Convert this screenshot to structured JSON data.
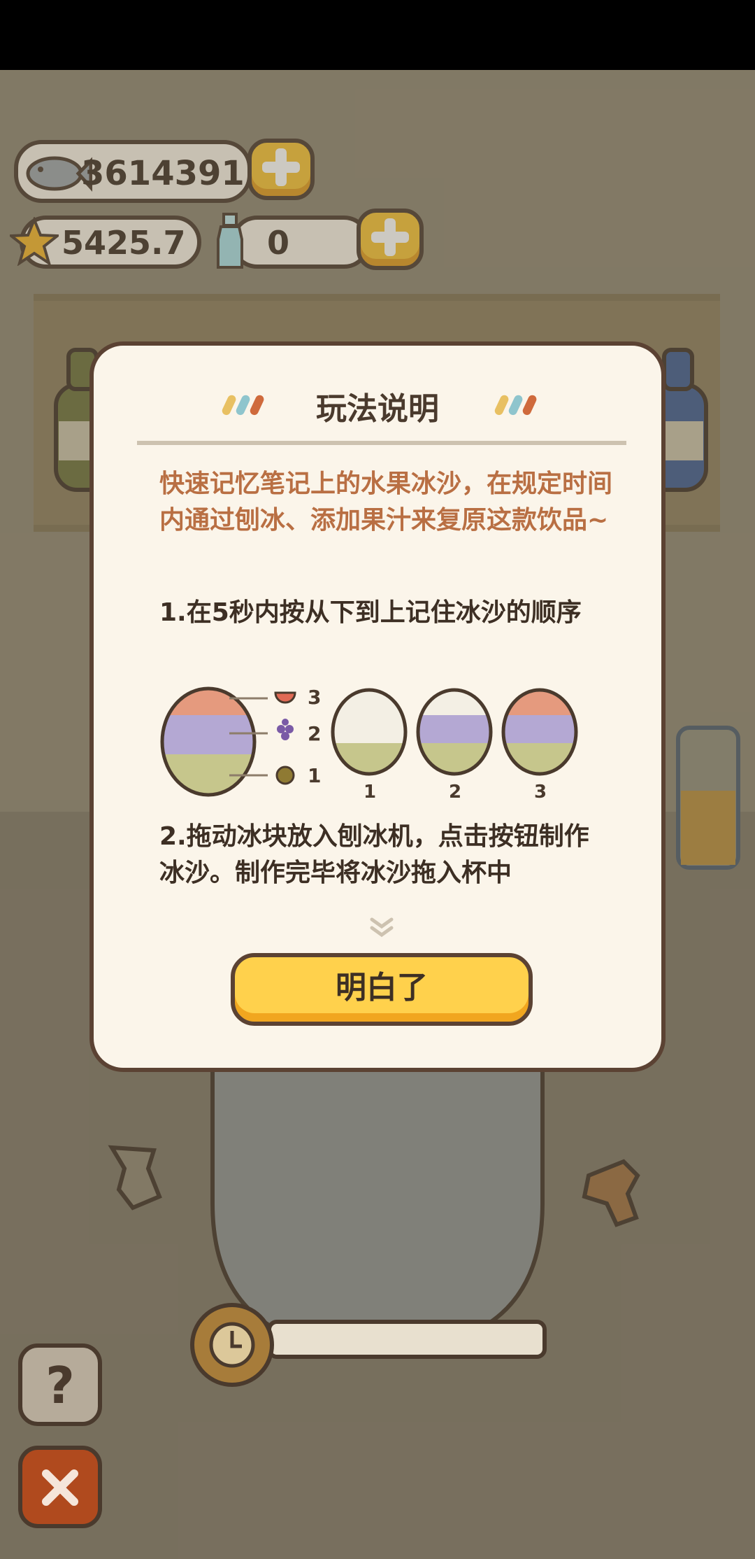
{
  "hud": {
    "fish_count": "3614391",
    "star_count": "5425.7",
    "bottle_count": "0",
    "icons": [
      "fish-icon",
      "star-icon",
      "bottle-icon",
      "plus-icon"
    ]
  },
  "dialog": {
    "title": "玩法说明",
    "intro": "快速记忆笔记上的水果冰沙，在规定时间内通过刨冰、添加果汁来复原这款饮品~",
    "step1": "1.在5秒内按从下到上记住冰沙的顺序",
    "diagram": {
      "legend_labels": [
        "3",
        "2",
        "1"
      ],
      "cup_labels": [
        "1",
        "2",
        "3"
      ]
    },
    "step2": "2.拖动冰块放入刨冰机，点击按钮制作冰沙。制作完毕将冰沙拖入杯中",
    "confirm_label": "明白了"
  },
  "colors": {
    "accent": "#ffd14c",
    "intro_text": "#b96f43",
    "layer_watermelon": "#e59a7e",
    "layer_grape": "#b4a8d3",
    "layer_kiwi": "#c6c68c"
  }
}
